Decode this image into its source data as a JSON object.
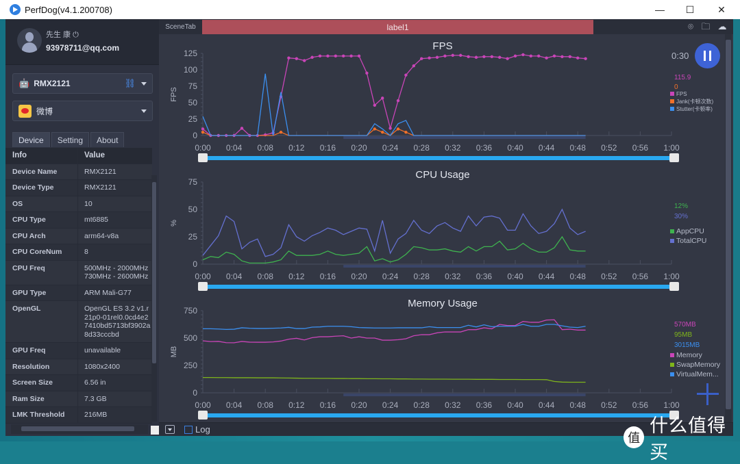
{
  "window": {
    "title": "PerfDog(v4.1.200708)",
    "controls": {
      "minimize": "—",
      "maximize": "☐",
      "close": "✕"
    }
  },
  "user": {
    "name": "先生 康 ⏻",
    "email": "93978711@qq.com"
  },
  "device_select": {
    "value": "RMX2121"
  },
  "app_select": {
    "value": "微博"
  },
  "tabs": [
    {
      "label": "Device",
      "active": true
    },
    {
      "label": "Setting"
    },
    {
      "label": "About"
    }
  ],
  "info_table": {
    "headers": [
      "Info",
      "Value"
    ],
    "rows": [
      [
        "Device Name",
        "RMX2121"
      ],
      [
        "Device Type",
        "RMX2121"
      ],
      [
        "OS",
        "10"
      ],
      [
        "CPU Type",
        "mt6885"
      ],
      [
        "CPU Arch",
        "arm64-v8a"
      ],
      [
        "CPU CoreNum",
        "8"
      ],
      [
        "CPU Freq",
        "500MHz - 2000MHz 730MHz - 2600MHz"
      ],
      [
        "GPU Type",
        "ARM Mali-G77"
      ],
      [
        "OpenGL",
        "OpenGL ES 3.2 v1.r21p0-01rel0.0cd4e27410bd5713bf3902a8d33cccbd"
      ],
      [
        "GPU Freq",
        "unavailable"
      ],
      [
        "Resolution",
        "1080x2400"
      ],
      [
        "Screen Size",
        "6.56 in"
      ],
      [
        "Ram Size",
        "7.3 GB"
      ],
      [
        "LMK Threshold",
        "216MB"
      ]
    ]
  },
  "topbar": {
    "scene_tab": "SceneTab",
    "label": "label1",
    "label_color": "#ad4f5a",
    "icons": [
      "location-icon",
      "folder-icon",
      "cloud-icon"
    ]
  },
  "elapsed": "0:30",
  "bottombar": {
    "log_label": "Log",
    "log_checked": false
  },
  "watermark": {
    "glyph": "值",
    "text": "什么值得买"
  },
  "chart_data": [
    {
      "type": "line",
      "title": "FPS",
      "ylabel": "FPS",
      "ylim": [
        0,
        125
      ],
      "yticks": [
        0,
        25,
        50,
        75,
        100,
        125
      ],
      "xlim": [
        "0:00",
        "1:00"
      ],
      "xticks": [
        "0:00",
        "0:04",
        "0:08",
        "0:12",
        "0:16",
        "0:20",
        "0:24",
        "0:28",
        "0:32",
        "0:36",
        "0:40",
        "0:44",
        "0:48",
        "0:52",
        "0:56",
        "1:00"
      ],
      "x_unit": "seconds",
      "legend_placement": "right",
      "series": [
        {
          "name": "FPS",
          "color": "#c945b8",
          "current": "115.9",
          "markers": true,
          "values": [
            10,
            0,
            0,
            0,
            0,
            11,
            0,
            0,
            1,
            4,
            59,
            118,
            117,
            114,
            119,
            121,
            121,
            121,
            121,
            121,
            121,
            95,
            46,
            57,
            11,
            53,
            92,
            106,
            117,
            118,
            119,
            121,
            122,
            122,
            120,
            119,
            120,
            120,
            119,
            117,
            121,
            123,
            121,
            121,
            118,
            121,
            120,
            120,
            118,
            117
          ]
        },
        {
          "name": "Jank(卡顿次数)",
          "color": "#f0702a",
          "current": "0",
          "markers": true,
          "values": [
            5,
            0,
            0,
            0,
            0,
            0,
            0,
            0,
            0,
            0,
            5,
            0,
            0,
            0,
            0,
            0,
            0,
            0,
            0,
            0,
            0,
            0,
            10,
            5,
            0,
            10,
            5,
            0,
            0,
            0,
            0,
            0,
            0,
            0,
            0,
            0,
            0,
            0,
            0,
            0,
            0,
            0,
            0,
            0,
            0,
            0,
            0,
            0,
            0,
            0
          ]
        },
        {
          "name": "Stutter(卡顿率)",
          "color": "#3b8fef",
          "markers": false,
          "values": [
            29,
            0,
            0,
            0,
            0,
            0,
            0,
            0,
            94,
            0,
            66,
            0,
            0,
            0,
            0,
            0,
            0,
            0,
            0,
            0,
            0,
            0,
            18,
            10,
            0,
            18,
            23,
            0,
            0,
            0,
            0,
            0,
            0,
            0,
            0,
            0,
            0,
            0,
            0,
            0,
            0,
            0,
            0,
            0,
            0,
            0,
            0,
            0,
            0,
            0
          ]
        }
      ]
    },
    {
      "type": "line",
      "title": "CPU Usage",
      "ylabel": "%",
      "ylim": [
        0,
        75
      ],
      "yticks": [
        0,
        25,
        50,
        75
      ],
      "xlim": [
        "0:00",
        "1:00"
      ],
      "xticks": [
        "0:00",
        "0:04",
        "0:08",
        "0:12",
        "0:16",
        "0:20",
        "0:24",
        "0:28",
        "0:32",
        "0:36",
        "0:40",
        "0:44",
        "0:48",
        "0:52",
        "0:56",
        "1:00"
      ],
      "x_unit": "seconds",
      "legend_placement": "right",
      "series": [
        {
          "name": "AppCPU",
          "color": "#3fb24f",
          "current": "12%",
          "values": [
            4,
            7,
            6,
            11,
            9,
            3,
            1,
            1,
            1,
            2,
            4,
            12,
            8,
            8,
            8,
            9,
            12,
            9,
            8,
            9,
            10,
            16,
            3,
            5,
            2,
            4,
            9,
            16,
            15,
            13,
            13,
            14,
            12,
            11,
            16,
            12,
            16,
            16,
            21,
            13,
            14,
            19,
            14,
            11,
            11,
            15,
            25,
            13,
            12,
            12
          ]
        },
        {
          "name": "TotalCPU",
          "color": "#6470d0",
          "current": "30%",
          "values": [
            8,
            17,
            26,
            44,
            39,
            14,
            20,
            23,
            7,
            9,
            15,
            36,
            25,
            21,
            26,
            29,
            33,
            31,
            27,
            30,
            33,
            32,
            12,
            40,
            10,
            23,
            28,
            40,
            31,
            28,
            35,
            38,
            33,
            30,
            44,
            35,
            43,
            44,
            42,
            31,
            31,
            46,
            35,
            28,
            30,
            37,
            50,
            33,
            27,
            30
          ]
        }
      ]
    },
    {
      "type": "line",
      "title": "Memory Usage",
      "ylabel": "MB",
      "ylim": [
        0,
        750
      ],
      "yticks": [
        0,
        250,
        500,
        750
      ],
      "xlim": [
        "0:00",
        "1:00"
      ],
      "xticks": [
        "0:00",
        "0:04",
        "0:08",
        "0:12",
        "0:16",
        "0:20",
        "0:24",
        "0:28",
        "0:32",
        "0:36",
        "0:40",
        "0:44",
        "0:48",
        "0:52",
        "0:56",
        "1:00"
      ],
      "x_unit": "seconds",
      "legend_placement": "right",
      "series": [
        {
          "name": "Memory",
          "color": "#c945b8",
          "current": "570MB",
          "values": [
            475,
            468,
            470,
            458,
            457,
            469,
            463,
            462,
            462,
            465,
            473,
            490,
            498,
            483,
            504,
            512,
            512,
            517,
            521,
            500,
            512,
            500,
            500,
            481,
            481,
            485,
            494,
            521,
            531,
            531,
            548,
            556,
            556,
            556,
            577,
            577,
            594,
            585,
            625,
            615,
            615,
            652,
            644,
            644,
            665,
            667,
            577,
            581,
            573,
            573
          ]
        },
        {
          "name": "SwapMemory",
          "color": "#7fb51b",
          "current": "95MB",
          "values": [
            140,
            140,
            139,
            139,
            138,
            138,
            138,
            137,
            137,
            137,
            136,
            135,
            134,
            133,
            133,
            132,
            132,
            131,
            131,
            130,
            130,
            129,
            129,
            128,
            128,
            127,
            127,
            126,
            126,
            125,
            125,
            125,
            124,
            124,
            124,
            123,
            123,
            123,
            122,
            122,
            122,
            121,
            121,
            121,
            120,
            104,
            98,
            97,
            97,
            97
          ]
        },
        {
          "name": "VirtualMem...",
          "color": "#3b8fef",
          "current": "3015MB",
          "values": [
            585,
            585,
            583,
            579,
            581,
            594,
            590,
            588,
            588,
            590,
            592,
            598,
            587,
            587,
            600,
            602,
            608,
            608,
            608,
            604,
            596,
            594,
            592,
            592,
            592,
            594,
            594,
            594,
            594,
            604,
            596,
            596,
            596,
            596,
            617,
            602,
            621,
            604,
            608,
            608,
            608,
            625,
            608,
            608,
            625,
            625,
            612,
            600,
            596,
            608
          ]
        }
      ]
    }
  ]
}
